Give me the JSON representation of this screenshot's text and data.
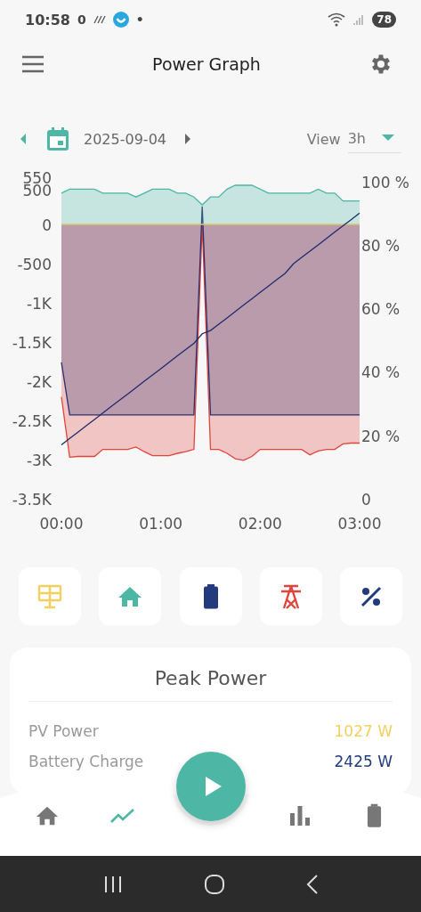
{
  "status_bar": {
    "time": "10:58",
    "notification_count": "0",
    "dot": "•",
    "battery": "78"
  },
  "header": {
    "title": "Power Graph"
  },
  "date_bar": {
    "date": "2025-09-04",
    "view_label": "View",
    "view_value": "3h"
  },
  "chart": {
    "chart_data": {
      "type": "area",
      "x": [
        0,
        5,
        10,
        15,
        20,
        25,
        30,
        35,
        40,
        45,
        50,
        55,
        60,
        65,
        70,
        75,
        80,
        85,
        90,
        95,
        100,
        105,
        110,
        115,
        120,
        125,
        130,
        135,
        140,
        145,
        150,
        155,
        160,
        165,
        170,
        175,
        180
      ],
      "xlim": [
        0,
        180
      ],
      "ylim": [
        -3500,
        550
      ],
      "y2lim": [
        0,
        100
      ],
      "xticks": [
        {
          "value": 0,
          "label": "00:00"
        },
        {
          "value": 60,
          "label": "01:00"
        },
        {
          "value": 120,
          "label": "02:00"
        },
        {
          "value": 180,
          "label": "03:00"
        }
      ],
      "yticks": [
        {
          "value": 550,
          "label": "550"
        },
        {
          "value": 500,
          "label": "500"
        },
        {
          "value": 0,
          "label": "0"
        },
        {
          "value": -500,
          "label": "-500"
        },
        {
          "value": -1000,
          "label": "-1K"
        },
        {
          "value": -1500,
          "label": "-1.5K"
        },
        {
          "value": -2000,
          "label": "-2K"
        },
        {
          "value": -2500,
          "label": "-2.5K"
        },
        {
          "value": -3000,
          "label": "-3K"
        },
        {
          "value": -3500,
          "label": "-3.5K"
        }
      ],
      "y2ticks": [
        {
          "value": 100,
          "label": "100 %"
        },
        {
          "value": 80,
          "label": "80 %"
        },
        {
          "value": 60,
          "label": "60 %"
        },
        {
          "value": 40,
          "label": "40 %"
        },
        {
          "value": 20,
          "label": "20 %"
        },
        {
          "value": 0,
          "label": "0"
        }
      ],
      "series": [
        {
          "color": "#e0453c",
          "values": [
            -2200,
            -2970,
            -2960,
            -2960,
            -2960,
            -2870,
            -2870,
            -2870,
            -2870,
            -2840,
            -2900,
            -2950,
            -2950,
            -2950,
            -2920,
            -2900,
            -2870,
            0,
            -2870,
            -2870,
            -2920,
            -2990,
            -3010,
            -2960,
            -2870,
            -2870,
            -2870,
            -2870,
            -2870,
            -2870,
            -2940,
            -2890,
            -2870,
            -2870,
            -2800,
            -2790,
            -2790
          ]
        },
        {
          "color": "#2b2f6e",
          "values": [
            -1760,
            -2430,
            -2430,
            -2430,
            -2430,
            -2430,
            -2430,
            -2430,
            -2430,
            -2430,
            -2430,
            -2430,
            -2430,
            -2430,
            -2430,
            -2430,
            -2430,
            230,
            -2430,
            -2430,
            -2430,
            -2430,
            -2430,
            -2430,
            -2430,
            -2430,
            -2430,
            -2430,
            -2430,
            -2430,
            -2430,
            -2430,
            -2430,
            -2430,
            -2430,
            -2430,
            -2430
          ]
        },
        {
          "color": "#4db6a4",
          "values": [
            400,
            450,
            450,
            450,
            450,
            400,
            400,
            400,
            400,
            350,
            400,
            450,
            450,
            450,
            400,
            400,
            350,
            250,
            350,
            350,
            450,
            500,
            500,
            500,
            450,
            400,
            400,
            400,
            400,
            400,
            400,
            450,
            400,
            400,
            300,
            300,
            300
          ]
        },
        {
          "type": "line",
          "color": "#d8c46a",
          "values": [
            0,
            0,
            0,
            0,
            0,
            0,
            0,
            0,
            0,
            0,
            0,
            0,
            0,
            0,
            0,
            0,
            0,
            0,
            0,
            0,
            0,
            0,
            0,
            0,
            0,
            0,
            0,
            0,
            0,
            0,
            0,
            0,
            0,
            0,
            0,
            0,
            0
          ]
        },
        {
          "axis": "y2",
          "type": "line",
          "color": "#1e2a6e",
          "values": [
            17,
            19,
            21,
            23,
            25,
            27,
            29,
            31,
            33,
            35,
            37,
            39,
            41,
            43,
            45,
            47,
            49,
            52,
            53,
            55,
            57,
            59,
            61,
            63,
            65,
            67,
            69,
            71,
            74,
            76,
            78,
            80,
            82,
            84,
            86,
            88,
            90
          ]
        }
      ]
    }
  },
  "series_buttons": [
    {
      "kind": "pv",
      "color": "#f2d060"
    },
    {
      "kind": "home",
      "color": "#4db6a4"
    },
    {
      "kind": "battery",
      "color": "#233a7d"
    },
    {
      "kind": "grid",
      "color": "#e0453c"
    },
    {
      "kind": "percent",
      "color": "#233a7d"
    }
  ],
  "peak_card": {
    "title": "Peak Power",
    "rows": [
      {
        "label": "PV Power",
        "value": "1027 W",
        "color": "#f2d060"
      },
      {
        "label": "Battery Charge",
        "value": "2425 W",
        "color": "#233a7d"
      }
    ]
  },
  "bottom_nav": {
    "items": [
      {
        "kind": "home",
        "selected": false
      },
      {
        "kind": "trend",
        "selected": true
      },
      {
        "kind": "bars",
        "selected": false
      },
      {
        "kind": "battery",
        "selected": false
      }
    ],
    "fab": {
      "kind": "play"
    }
  }
}
